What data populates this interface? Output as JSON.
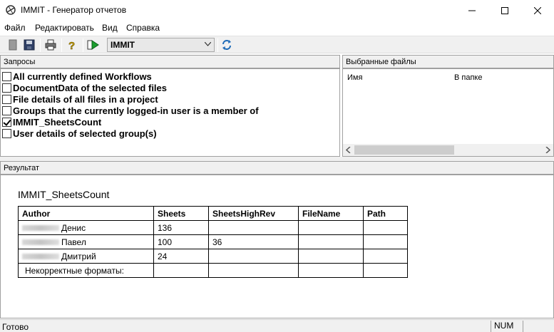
{
  "window": {
    "title": "IMMIT - Генератор отчетов"
  },
  "menu": {
    "items": [
      "Файл",
      "Редактировать",
      "Вид",
      "Справка"
    ]
  },
  "toolbar": {
    "combo_value": "IMMIT"
  },
  "queries": {
    "header": "Запросы",
    "items": [
      {
        "label": "All currently defined Workflows",
        "checked": false
      },
      {
        "label": "DocumentData of the selected files",
        "checked": false
      },
      {
        "label": "File details of all files in a project",
        "checked": false
      },
      {
        "label": "Groups that the currently logged-in user is a member of",
        "checked": false
      },
      {
        "label": "IMMIT_SheetsCount",
        "checked": true
      },
      {
        "label": "User details of selected group(s)",
        "checked": false
      }
    ]
  },
  "selected_files": {
    "header": "Выбранные файлы",
    "columns": [
      "Имя",
      "В папке"
    ]
  },
  "result": {
    "header": "Результат",
    "title": "IMMIT_SheetsCount",
    "columns": [
      "Author",
      "Sheets",
      "SheetsHighRev",
      "FileName",
      "Path"
    ],
    "rows": [
      [
        "Денис",
        "136",
        "",
        "",
        ""
      ],
      [
        "Павел",
        "100",
        "36",
        "",
        ""
      ],
      [
        "Дмитрий",
        "24",
        "",
        "",
        ""
      ]
    ],
    "footer_label": "Некорректные форматы:"
  },
  "status": {
    "text": "Готово",
    "num": "NUM"
  }
}
